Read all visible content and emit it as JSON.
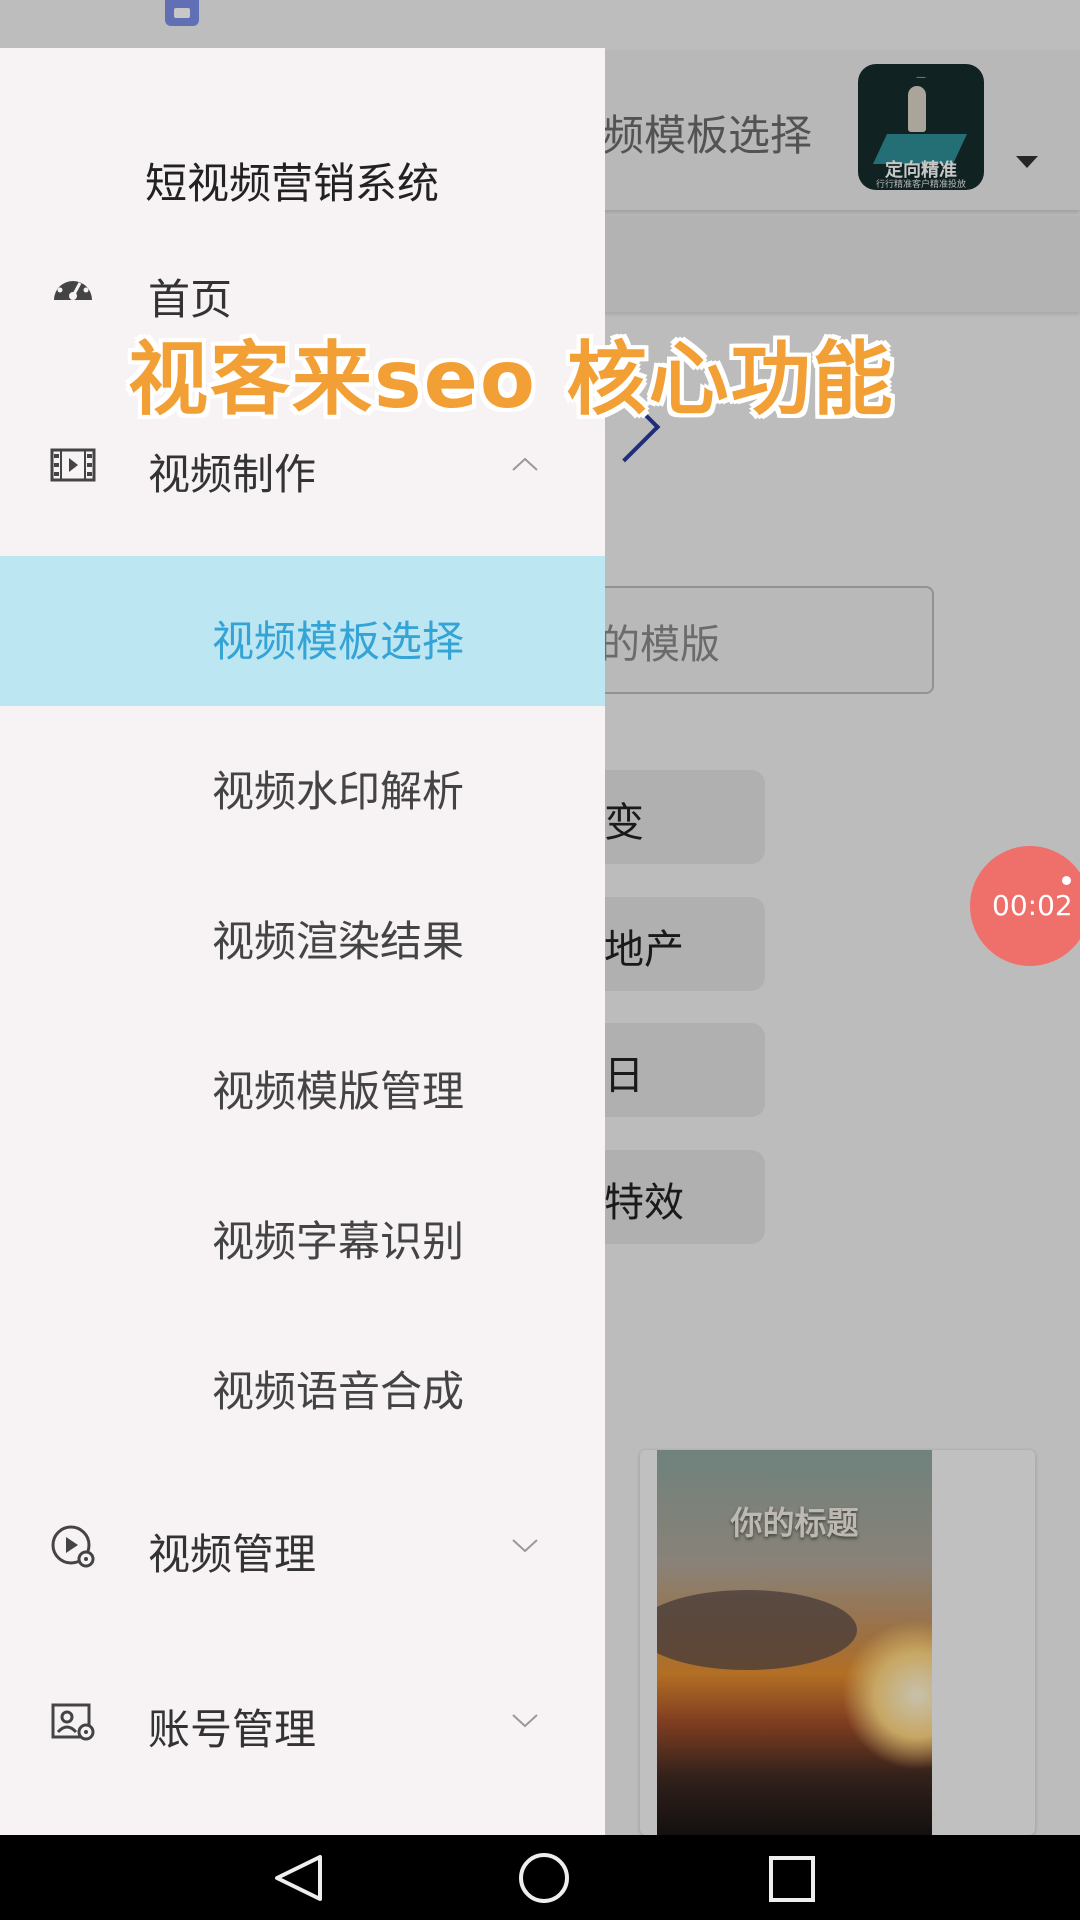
{
  "background": {
    "header_title": "视频模板选择",
    "logo_text": "定向精准",
    "logo_tagline": "行行精准客户精准投放",
    "search_placeholder": "的模版",
    "chips": [
      "变",
      "地产",
      "日",
      "特效"
    ],
    "thumbnail_title": "你的标题"
  },
  "drawer": {
    "title": "短视频营销系统",
    "menu": [
      {
        "label": "首页",
        "icon": "dashboard-icon"
      },
      {
        "label": "视频制作",
        "icon": "film-icon",
        "expanded": true
      },
      {
        "label": "视频管理",
        "icon": "video-settings-icon",
        "expanded": false
      },
      {
        "label": "账号管理",
        "icon": "account-card-icon",
        "expanded": false
      }
    ],
    "video_production_items": [
      {
        "label": "视频模板选择",
        "active": true
      },
      {
        "label": "视频水印解析"
      },
      {
        "label": "视频渲染结果"
      },
      {
        "label": "视频模版管理"
      },
      {
        "label": "视频字幕识别"
      },
      {
        "label": "视频语音合成"
      }
    ]
  },
  "overlay": {
    "banner": "视客来seo 核心功能",
    "recording_timer": "00:02"
  },
  "navbar": {
    "buttons": [
      "back-icon",
      "home-icon",
      "recents-icon"
    ]
  },
  "colors": {
    "active_bg": "#bde6f3",
    "active_text": "#34a3d6",
    "banner": "#f2a036",
    "timer": "#ef6f6a"
  }
}
